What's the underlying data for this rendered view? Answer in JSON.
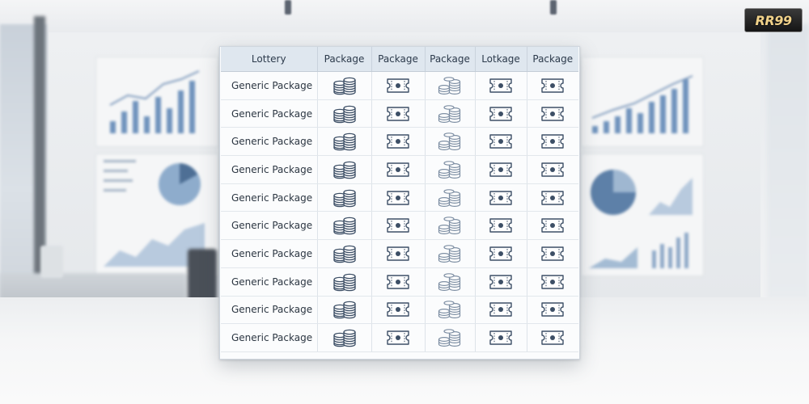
{
  "logo": {
    "text": "RR99"
  },
  "table": {
    "headers": [
      "Lottery",
      "Package",
      "Package",
      "Package",
      "Lotkage",
      "Package"
    ],
    "column_icons": [
      "coin-stack-icon",
      "ticket-icon",
      "coin-stack-light-icon",
      "ticket-icon",
      "ticket-icon"
    ],
    "rows": [
      "Generic Package",
      "Generic Package",
      "Generic Package",
      "Generic Package",
      "Generic Package",
      "Generic Package",
      "Generic Package",
      "Generic Package",
      "Generic Package",
      "Generic Package"
    ]
  },
  "colors": {
    "header_bg": "#dfe7ef",
    "icon_dark": "#3d4f66",
    "icon_light": "#7d8ea3",
    "logo_text": "#f1d28a"
  }
}
